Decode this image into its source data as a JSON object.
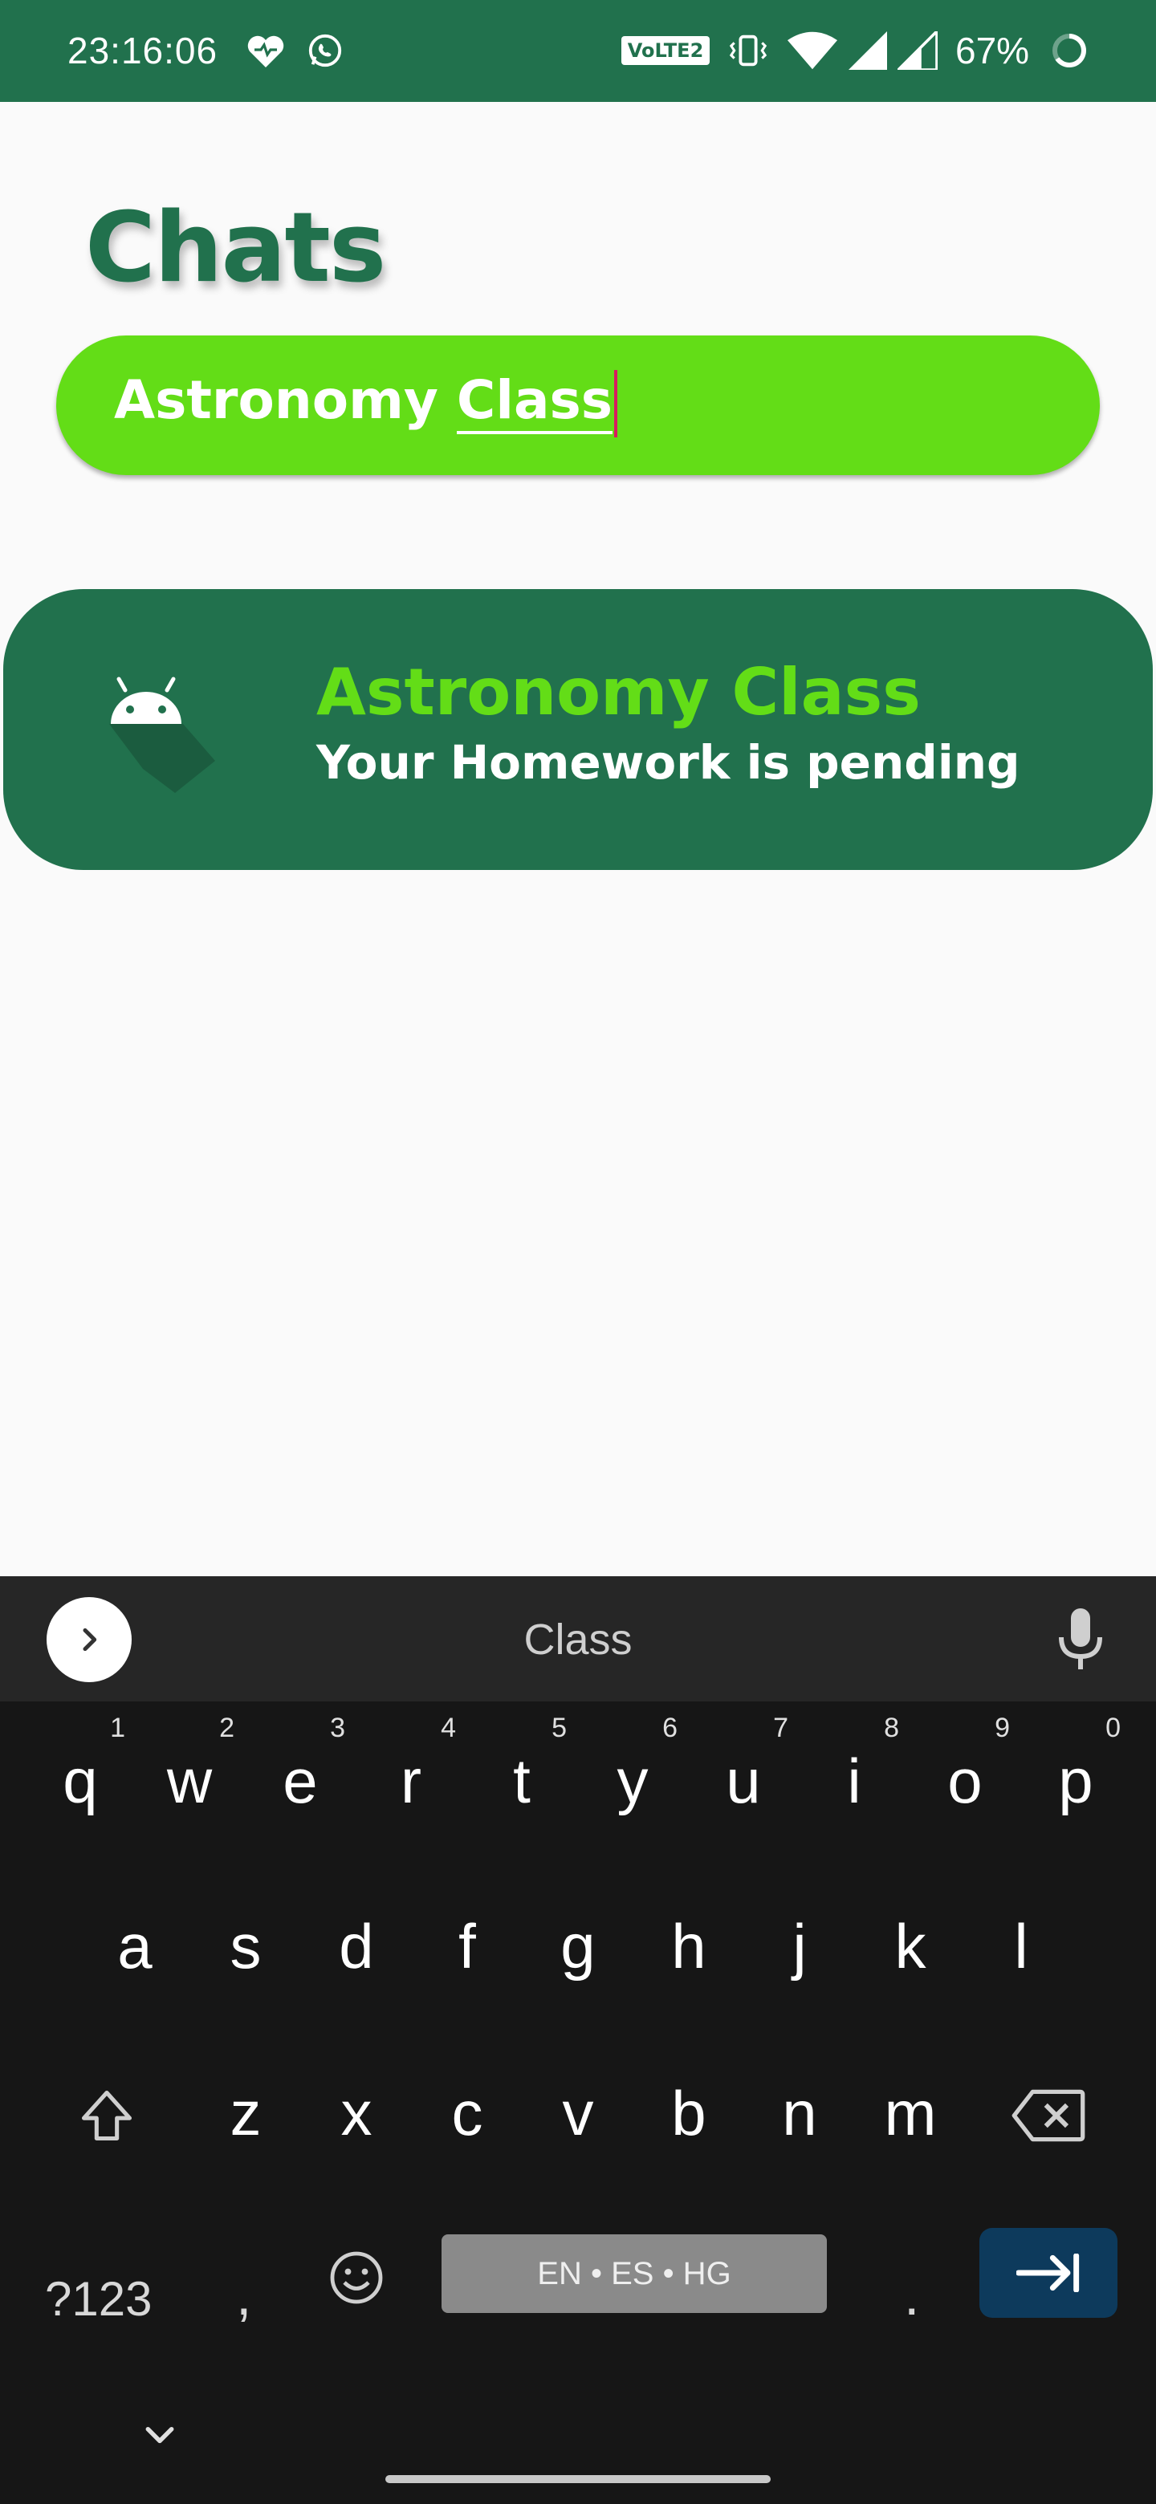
{
  "status_bar": {
    "time": "23:16:06",
    "volte": "VoLTE2",
    "battery": "67%",
    "background": "#21714d"
  },
  "header": {
    "title": "Chats",
    "color": "#21714d"
  },
  "search": {
    "value_prefix": "Astronomy ",
    "value_underlined": "Class",
    "background": "#63dd17"
  },
  "chats": [
    {
      "name": "Astronomy Class",
      "last_message": "Your Homework is pending",
      "avatar_icon": "android-icon"
    }
  ],
  "keyboard": {
    "suggestion": "Class",
    "row1": [
      {
        "key": "q",
        "hint": "1"
      },
      {
        "key": "w",
        "hint": "2"
      },
      {
        "key": "e",
        "hint": "3"
      },
      {
        "key": "r",
        "hint": "4"
      },
      {
        "key": "t",
        "hint": "5"
      },
      {
        "key": "y",
        "hint": "6"
      },
      {
        "key": "u",
        "hint": "7"
      },
      {
        "key": "i",
        "hint": "8"
      },
      {
        "key": "o",
        "hint": "9"
      },
      {
        "key": "p",
        "hint": "0"
      }
    ],
    "row2": [
      "a",
      "s",
      "d",
      "f",
      "g",
      "h",
      "j",
      "k",
      "l"
    ],
    "row3": [
      "z",
      "x",
      "c",
      "v",
      "b",
      "n",
      "m"
    ],
    "symbols_label": "?123",
    "comma": ",",
    "period": ".",
    "space_label": "EN • ES • HG"
  }
}
